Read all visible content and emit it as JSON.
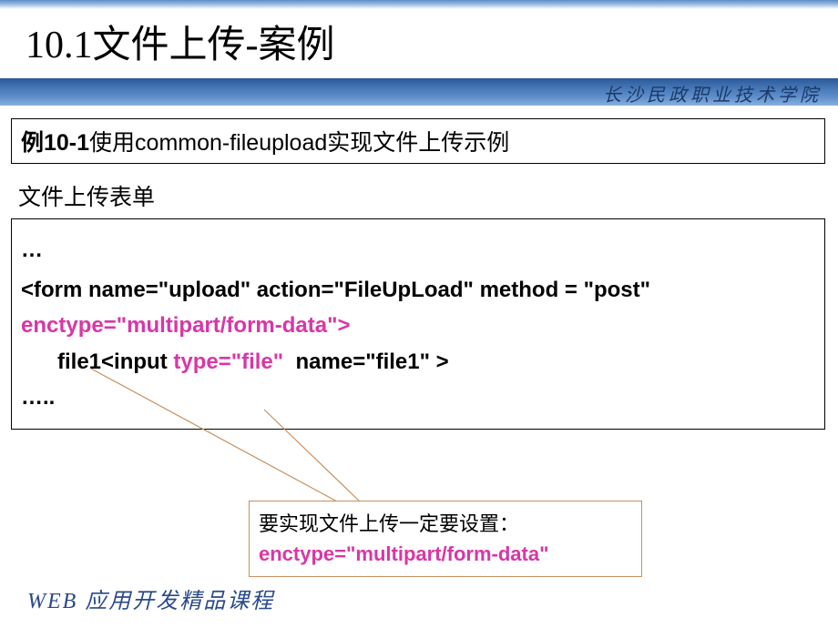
{
  "title": "10.1文件上传-案例",
  "institution": "长沙民政职业技术学院",
  "example": {
    "number": "例10-1",
    "description": "使用common-fileupload实现文件上传示例"
  },
  "section_label": "文件上传表单",
  "code": {
    "line_dots_top": "…",
    "line_form_start": "<form name=\"upload\" action=\"FileUpLoad\" method = \"post\"",
    "line_enctype": "enctype=\"multipart/form-data\">",
    "line_file_prefix": "file1<input",
    "line_file_type": "type=\"file\"",
    "line_file_suffix": "name=\"file1\" >",
    "line_dots_bottom": "….."
  },
  "annotation": {
    "text": "要实现文件上传一定要设置：",
    "code": "enctype=\"multipart/form-data\""
  },
  "footer": "WEB 应用开发精品课程"
}
